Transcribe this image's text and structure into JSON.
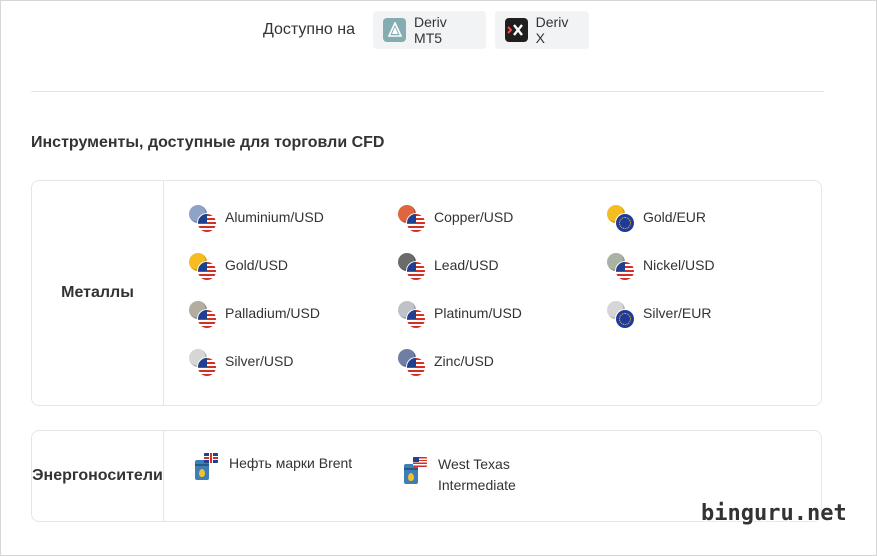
{
  "availability": {
    "label": "Доступно на",
    "platforms": [
      {
        "name": "Deriv MT5",
        "icon": "deriv-mt5-icon",
        "color": "#85acb0"
      },
      {
        "name": "Deriv X",
        "icon": "deriv-x-icon",
        "color": "#1f1f1f"
      }
    ]
  },
  "section_title": "Инструменты, доступные для торговли CFD",
  "categories": [
    {
      "name": "Металлы",
      "instruments": [
        {
          "label": "Aluminium/USD",
          "coin_color": "#8fa3c9",
          "flag": "us"
        },
        {
          "label": "Copper/USD",
          "coin_color": "#e0643e",
          "flag": "us"
        },
        {
          "label": "Gold/EUR",
          "coin_color": "#f5bd1f",
          "flag": "eu"
        },
        {
          "label": "Gold/USD",
          "coin_color": "#f5bd1f",
          "flag": "us"
        },
        {
          "label": "Lead/USD",
          "coin_color": "#6b6b6b",
          "flag": "us"
        },
        {
          "label": "Nickel/USD",
          "coin_color": "#a9b3a3",
          "flag": "us"
        },
        {
          "label": "Palladium/USD",
          "coin_color": "#b3aca1",
          "flag": "us"
        },
        {
          "label": "Platinum/USD",
          "coin_color": "#bfc3c8",
          "flag": "us"
        },
        {
          "label": "Silver/EUR",
          "coin_color": "#d6d6d6",
          "flag": "eu"
        },
        {
          "label": "Silver/USD",
          "coin_color": "#d6d6d6",
          "flag": "us"
        },
        {
          "label": "Zinc/USD",
          "coin_color": "#6f7fa3",
          "flag": "us"
        }
      ]
    },
    {
      "name": "Энергоносители",
      "instruments": [
        {
          "label": "Нефть марки Brent",
          "flag": "uk"
        },
        {
          "label_line1": "West Texas",
          "label_line2": "Intermediate",
          "flag": "us"
        }
      ]
    }
  ],
  "watermark": "binguru.net"
}
